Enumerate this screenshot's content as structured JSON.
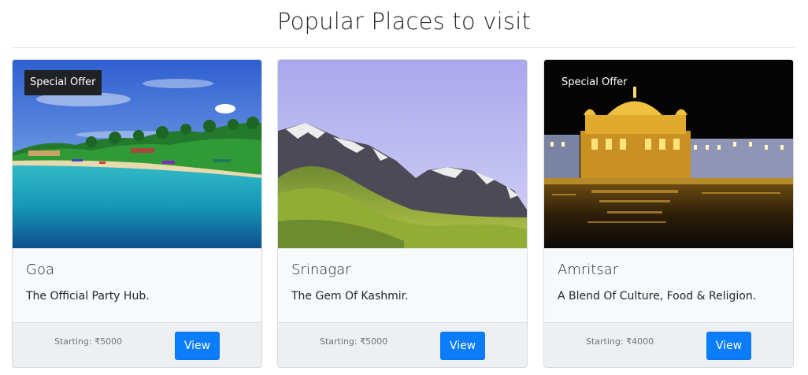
{
  "page": {
    "title": "Popular Places to visit"
  },
  "cards": [
    {
      "name": "Goa",
      "tagline": "The Official Party Hub.",
      "price": "Starting: ₹5000",
      "button": "View",
      "badge": "Special Offer",
      "image_icon": "beach-image"
    },
    {
      "name": "Srinagar",
      "tagline": "The Gem Of Kashmir.",
      "price": "Starting: ₹5000",
      "button": "View",
      "badge": "",
      "image_icon": "mountain-image"
    },
    {
      "name": "Amritsar",
      "tagline": "A Blend Of Culture, Food & Religion.",
      "price": "Starting: ₹4000",
      "button": "View",
      "badge": "Special Offer",
      "image_icon": "golden-temple-image"
    }
  ],
  "colors": {
    "primary_button": "#0b7dfb",
    "card_body": "#f8f9fa",
    "card_footer": "#eeeff0"
  }
}
